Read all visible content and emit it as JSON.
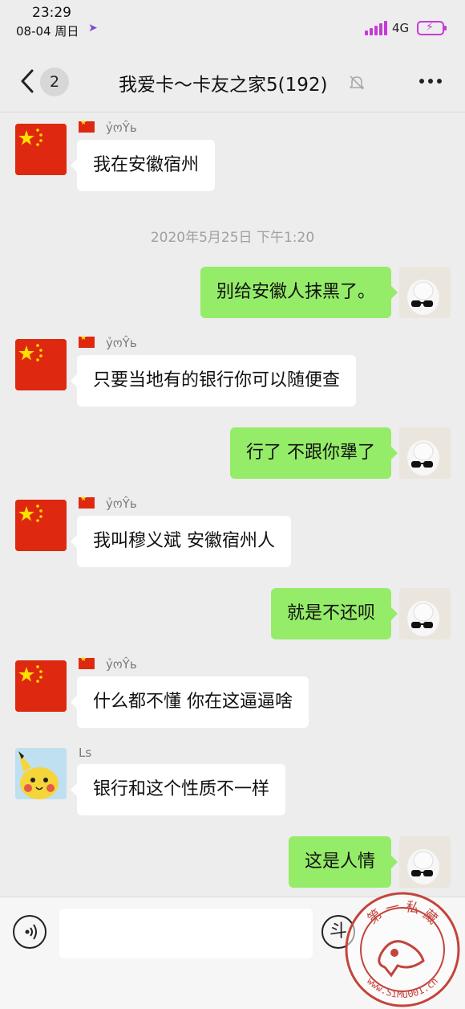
{
  "status_bar": {
    "time": "23:29",
    "date": "08-04 周日",
    "location_glyph": "➤",
    "network": "4G",
    "bolt": "⚡"
  },
  "header": {
    "unread_count": "2",
    "title": "我爱卡～卡友之家5(192)"
  },
  "timestamp": "2020年5月25日 下午1:20",
  "messages": {
    "m1": {
      "sender": "ỷოŶь",
      "text": "我在安徽宿州"
    },
    "m2": {
      "text": "别给安徽人抹黑了。"
    },
    "m3": {
      "sender": "ỷოŶь",
      "text": "只要当地有的银行你可以随便查"
    },
    "m4": {
      "text": "行了 不跟你犟了"
    },
    "m5": {
      "sender": "ỷოŶь",
      "text": "我叫穆义斌 安徽宿州人"
    },
    "m6": {
      "text": "就是不还呗"
    },
    "m7": {
      "sender": "ỷოŶь",
      "text": "什么都不懂 你在这逼逼啥"
    },
    "m8": {
      "sender": "Ls",
      "text": "银行和这个性质不一样"
    },
    "m9": {
      "text": "这是人情"
    }
  },
  "input_bar": {
    "emoji_glyph": "斗"
  },
  "watermark": {
    "top_text": "第 一 私 藏",
    "bottom_text": "www.SiMu001.cn"
  },
  "colors": {
    "outgoing_bubble": "#95ec69",
    "incoming_bubble": "#ffffff",
    "background": "#ededed",
    "seal_red": "#c4443c"
  }
}
